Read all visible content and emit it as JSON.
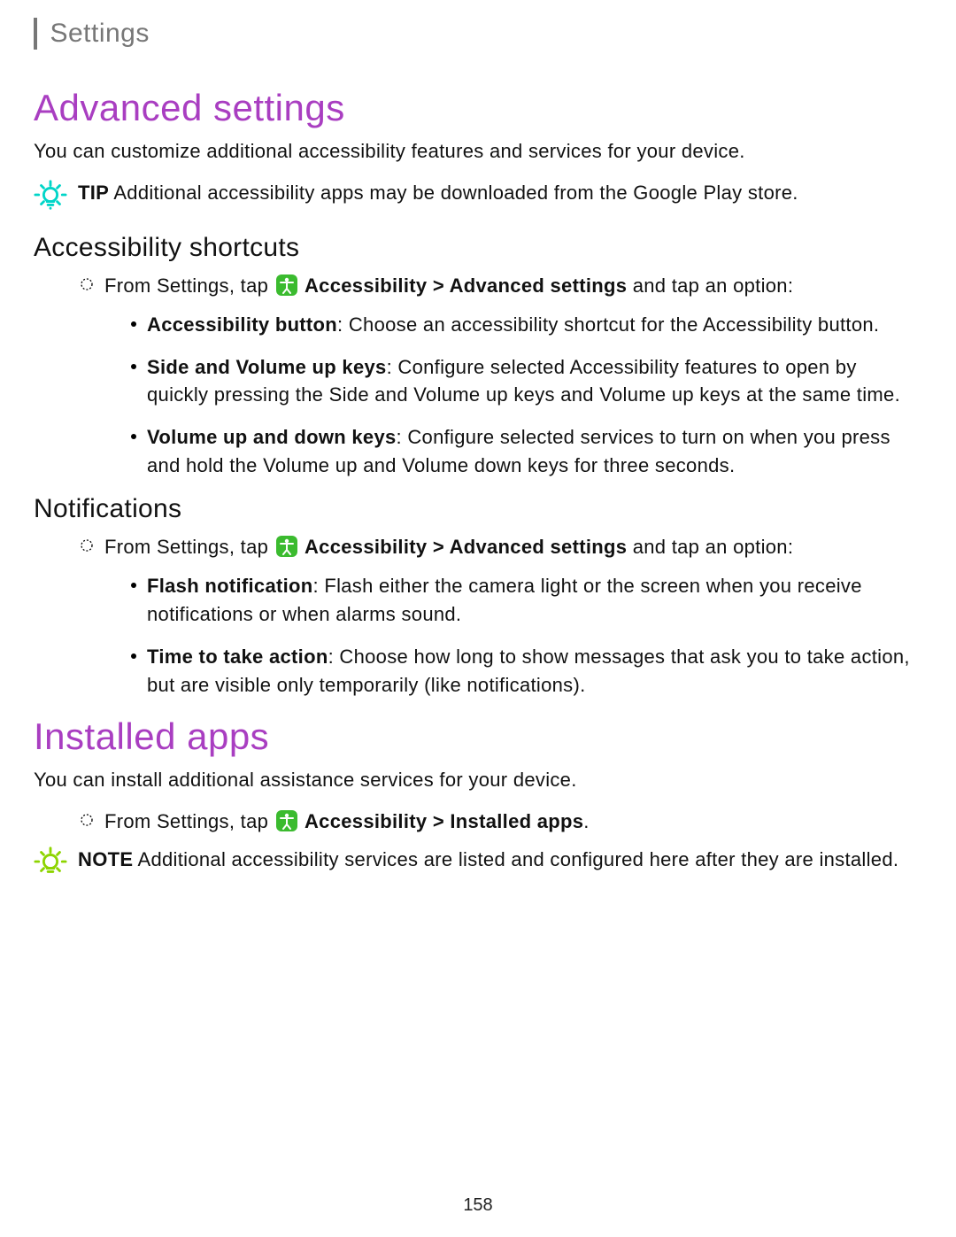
{
  "header": {
    "title": "Settings"
  },
  "section1": {
    "title": "Advanced settings",
    "intro": "You can customize additional accessibility features and services for your device.",
    "tip_label": "TIP",
    "tip_text": " Additional accessibility apps may be downloaded from the Google Play store."
  },
  "shortcuts": {
    "title": "Accessibility shortcuts",
    "lead_pre": "From Settings, tap ",
    "lead_acc": " Accessibility",
    "lead_sep": " > ",
    "lead_page": "Advanced settings",
    "lead_post": " and tap an option:",
    "items": [
      {
        "bold": "Accessibility button",
        "text": ": Choose an accessibility shortcut for the Accessibility button."
      },
      {
        "bold": "Side and Volume up keys",
        "text": ": Configure selected Accessibility features to open by quickly pressing the Side and Volume up keys and Volume up keys at the same time."
      },
      {
        "bold": "Volume up and down keys",
        "text": ": Configure selected services to turn on when you press and hold the Volume up and Volume down keys for three seconds."
      }
    ]
  },
  "notifications": {
    "title": "Notifications",
    "lead_pre": "From Settings, tap ",
    "lead_acc": " Accessibility",
    "lead_sep": " > ",
    "lead_page": "Advanced settings",
    "lead_post": " and tap an option:",
    "items": [
      {
        "bold": "Flash notification",
        "text": ": Flash either the camera light or the screen when you receive notifications or when alarms sound."
      },
      {
        "bold": "Time to take action",
        "text": ": Choose how long to show messages that ask you to take action, but are visible only temporarily (like notifications)."
      }
    ]
  },
  "installed": {
    "title": "Installed apps",
    "intro": "You can install additional assistance services for your device.",
    "lead_pre": "From Settings, tap ",
    "lead_acc": " Accessibility",
    "lead_sep": " > ",
    "lead_page": "Installed apps",
    "lead_post": ".",
    "note_label": "NOTE",
    "note_text": " Additional accessibility services are listed and configured here after they are installed."
  },
  "page_number": "158"
}
